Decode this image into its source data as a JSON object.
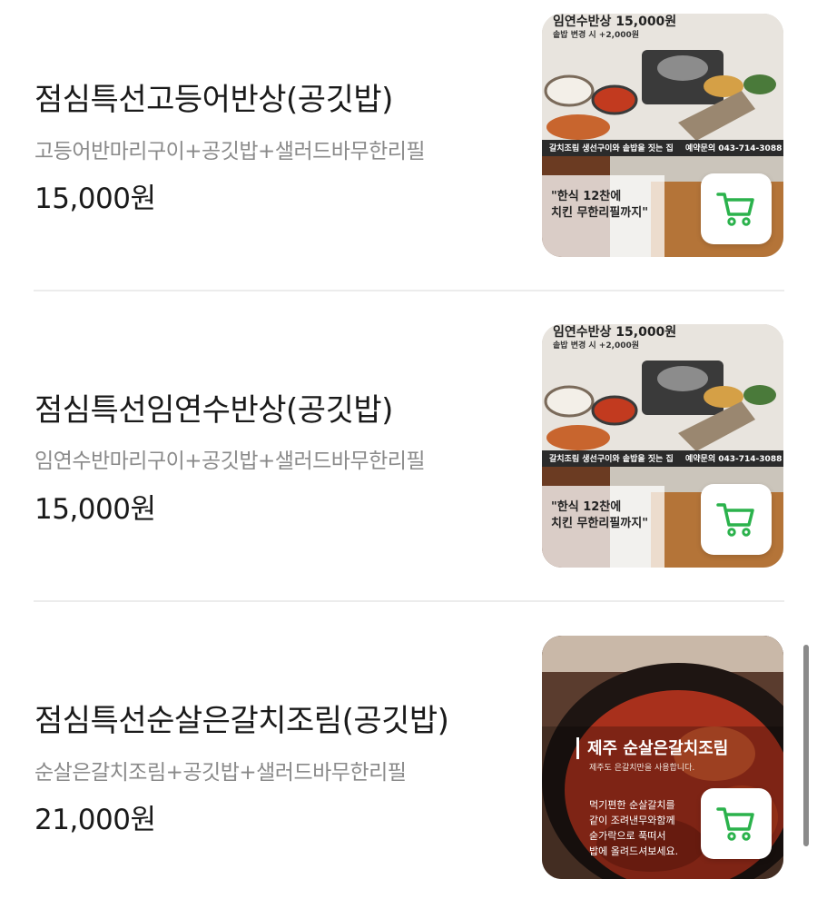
{
  "menu_items": [
    {
      "name": "점심특선고등어반상(공깃밥)",
      "description": "고등어반마리구이+공깃밥+샐러드바무한리필",
      "price": "15,000원",
      "image": {
        "headline": "임연수반상 15,000원",
        "subline": "솥밥 변경 시 +2,000원",
        "band_left": "갈치조림  생선구이와 솥밥을 짓는 집",
        "band_right": "예약문의 043-714-3088",
        "slogan_1": "\"한식 12찬에",
        "slogan_2": "치킨 무한리필까지\""
      }
    },
    {
      "name": "점심특선임연수반상(공깃밥)",
      "description": "임연수반마리구이+공깃밥+샐러드바무한리필",
      "price": "15,000원",
      "image": {
        "headline": "임연수반상 15,000원",
        "subline": "솥밥 변경 시 +2,000원",
        "band_left": "갈치조림  생선구이와 솥밥을 짓는 집",
        "band_right": "예약문의 043-714-3088",
        "slogan_1": "\"한식 12찬에",
        "slogan_2": "치킨 무한리필까지\""
      }
    },
    {
      "name": "점심특선순살은갈치조림(공깃밥)",
      "description": "순살은갈치조림+공깃밥+샐러드바무한리필",
      "price": "21,000원",
      "image": {
        "headline": "제주 순살은갈치조림",
        "subline": "제주도 은갈치만을 사용합니다.",
        "line_1": "먹기편한 순살갈치를",
        "line_2": "같이 조려낸무와함께",
        "line_3": "숟가락으로 푹떠서",
        "line_4": "밥에 올려드셔보세요."
      }
    }
  ],
  "colors": {
    "cart_icon": "#2bb24c",
    "divider": "#ececec"
  },
  "icons": {
    "cart": "shopping-cart-icon"
  }
}
